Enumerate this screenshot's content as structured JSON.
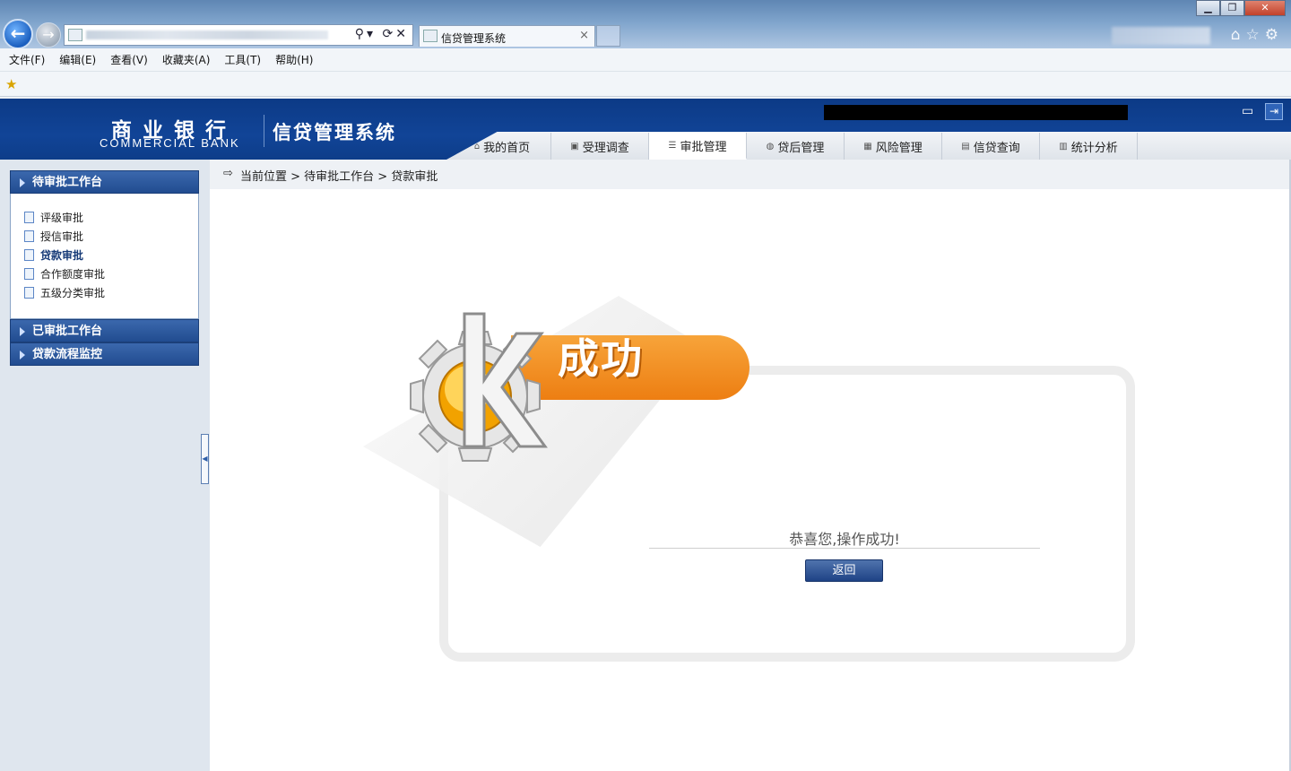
{
  "browser": {
    "tab_title": "信贷管理系统",
    "tab_close": "×",
    "window_buttons": {
      "minimize": "▁",
      "maximize": "❐",
      "close": "✕"
    },
    "addr_tools": "⚲▾ ⟳✕",
    "chrome_icons": "⌂☆⚙"
  },
  "menubar": {
    "items": [
      "文件(F)",
      "编辑(E)",
      "查看(V)",
      "收藏夹(A)",
      "工具(T)",
      "帮助(H)"
    ]
  },
  "header": {
    "bank_name_cn": "商业银行",
    "bank_name_en": "COMMERCIAL BANK",
    "system_title": "信贷管理系统"
  },
  "nav": {
    "tabs": [
      {
        "label": "我的首页",
        "icon": "home-icon",
        "glyph": "⌂"
      },
      {
        "label": "受理调查",
        "icon": "survey-icon",
        "glyph": "▣"
      },
      {
        "label": "审批管理",
        "icon": "approval-icon",
        "glyph": "☰"
      },
      {
        "label": "贷后管理",
        "icon": "postloan-icon",
        "glyph": "◍"
      },
      {
        "label": "风险管理",
        "icon": "risk-icon",
        "glyph": "▦"
      },
      {
        "label": "信贷查询",
        "icon": "query-icon",
        "glyph": "▤"
      },
      {
        "label": "统计分析",
        "icon": "stats-icon",
        "glyph": "▥"
      }
    ],
    "active": "审批管理"
  },
  "sidebar": {
    "panel_pending": "待审批工作台",
    "items": [
      "评级审批",
      "授信审批",
      "贷款审批",
      "合作额度审批",
      "五级分类审批"
    ],
    "active_item": "贷款审批",
    "panel_done": "已审批工作台",
    "panel_monitor": "贷款流程监控"
  },
  "breadcrumb": {
    "text": "当前位置 > 待审批工作台 > 贷款审批"
  },
  "result": {
    "title": "成功",
    "message": "恭喜您,操作成功!",
    "back_label": "返回"
  },
  "colors": {
    "header_blue": "#114497",
    "accent_orange": "#ed7e12",
    "button_blue": "#1f4386"
  }
}
